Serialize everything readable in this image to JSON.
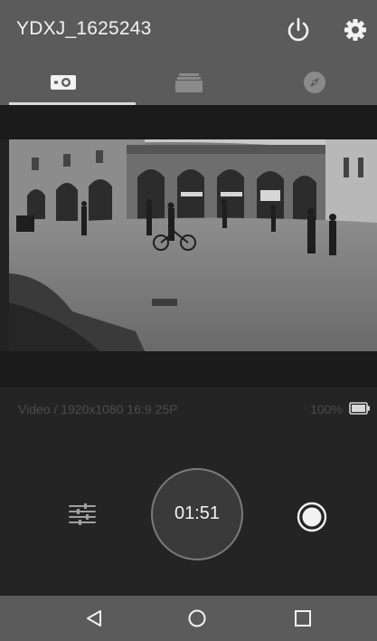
{
  "header": {
    "title": "YDXJ_1625243",
    "power_icon": "power-icon",
    "settings_icon": "gear-icon"
  },
  "tabs": [
    {
      "icon": "camera-icon",
      "active": true
    },
    {
      "icon": "gallery-icon",
      "active": false
    },
    {
      "icon": "compass-icon",
      "active": false
    }
  ],
  "preview": {
    "icon": "live-camera-preview"
  },
  "status": {
    "mode": "Video / 1920x1080 16:9 25P",
    "battery": "100%",
    "battery_level": 1.0
  },
  "controls": {
    "timer": "01:51",
    "settings_icon": "sliders-icon",
    "record_icon": "record-toggle-icon"
  },
  "navbar": {
    "back_icon": "back-triangle-icon",
    "home_icon": "home-circle-icon",
    "recent_icon": "recent-square-icon"
  },
  "colors": {
    "header_bg": "#5b5b5b",
    "body_bg": "#242424",
    "accent": "#ffffff",
    "muted_text": "#4c4c4c"
  }
}
